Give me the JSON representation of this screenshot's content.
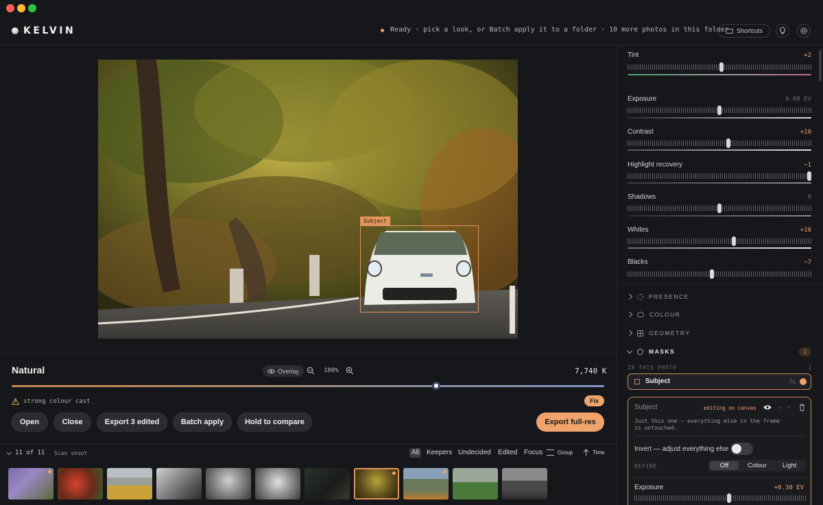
{
  "app": {
    "name": "KELVIN"
  },
  "header": {
    "status": "Ready · pick a look, or Batch apply it to a folder · 10 more photos in this folder",
    "shortcuts_label": "Shortcuts"
  },
  "canvas": {
    "mask_tag": "Subject"
  },
  "controls": {
    "look_name": "Natural",
    "overlay_label": "Overlay",
    "zoom": "100%",
    "kelvin_value": "7,740 K",
    "temperature_fraction": 0.716,
    "warning": "strong colour cast",
    "fix_label": "Fix",
    "buttons": {
      "open": "Open",
      "close": "Close",
      "export_edited": "Export 3 edited",
      "batch": "Batch apply",
      "compare": "Hold to compare"
    },
    "export_full": "Export full-res"
  },
  "filmstrip": {
    "count": "11 of 11",
    "scan": "Scan shoot",
    "filters": [
      "All",
      "Keepers",
      "Undecided",
      "Edited",
      "Focus"
    ],
    "group": "Group",
    "time": "Time",
    "selected_index": 7
  },
  "panel": {
    "sliders": [
      {
        "label": "Tint",
        "value": "+2",
        "pos": 0.51,
        "accent": true
      },
      {
        "label": "Exposure",
        "value": "0.00 EV",
        "pos": 0.5,
        "accent": false
      },
      {
        "label": "Contrast",
        "value": "+10",
        "pos": 0.55,
        "accent": true
      },
      {
        "label": "Highlight recovery",
        "value": "−1",
        "pos": 0.99,
        "accent": true
      },
      {
        "label": "Shadows",
        "value": "0",
        "pos": 0.5,
        "accent": false
      },
      {
        "label": "Whites",
        "value": "+16",
        "pos": 0.58,
        "accent": true
      },
      {
        "label": "Blacks",
        "value": "−7",
        "pos": 0.46,
        "accent": true
      }
    ],
    "sections": [
      "PRESENCE",
      "COLOUR",
      "GEOMETRY"
    ],
    "masks_label": "MASKS",
    "masks_count": "1",
    "in_this_photo": "IN THIS PHOTO",
    "mask_item": {
      "name": "Subject",
      "percent": "7%"
    },
    "mask_detail": {
      "title": "Subject",
      "editing": "editing on canvas",
      "description": "Just this one — everything else in the frame is untouched.",
      "invert_label": "Invert — adjust everything else",
      "refine_label": "REFINE",
      "refine_options": [
        "Off",
        "Colour",
        "Light"
      ],
      "exposure_label": "Exposure",
      "exposure_value": "+0.30 EV"
    }
  },
  "colors": {
    "accent": "#f0a36a",
    "mask": "#e2955c",
    "bg": "#16171b"
  }
}
